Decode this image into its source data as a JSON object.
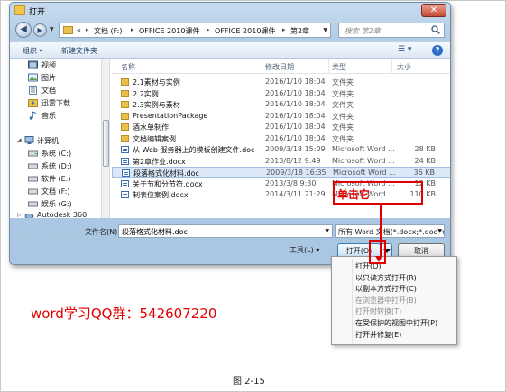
{
  "window": {
    "title": "打开",
    "close_label": "✕"
  },
  "address": {
    "prefix": "«",
    "crumbs": [
      "文档 (F:)",
      "OFFICE 2010课件",
      "OFFICE 2010课件",
      "第2章"
    ]
  },
  "search": {
    "placeholder": "搜索 第2章"
  },
  "toolbar": {
    "organize": "组织 ▾",
    "new_folder": "新建文件夹",
    "view": "☰ ▾",
    "help": "?"
  },
  "nav": {
    "items": [
      {
        "label": "视频",
        "icon": "video-library-icon"
      },
      {
        "label": "图片",
        "icon": "pictures-library-icon"
      },
      {
        "label": "文档",
        "icon": "documents-library-icon"
      },
      {
        "label": "迅雷下载",
        "icon": "thunder-download-icon"
      },
      {
        "label": "音乐",
        "icon": "music-library-icon"
      }
    ],
    "computer": {
      "label": "计算机",
      "icon": "computer-icon"
    },
    "drives": [
      {
        "label": "系统 (C:)"
      },
      {
        "label": "系统 (D:)"
      },
      {
        "label": "软件 (E:)"
      },
      {
        "label": "文档 (F:)"
      },
      {
        "label": "娱乐 (G:)"
      },
      {
        "label": "Autodesk 360"
      }
    ]
  },
  "columns": {
    "name": "名称",
    "date": "修改日期",
    "type": "类型",
    "size": "大小"
  },
  "files": [
    {
      "name": "2.1素材与实例",
      "date": "2016/1/10 18:04",
      "type": "文件夹",
      "size": "",
      "kind": "folder"
    },
    {
      "name": "2.2实例",
      "date": "2016/1/10 18:04",
      "type": "文件夹",
      "size": "",
      "kind": "folder"
    },
    {
      "name": "2.3实例与素材",
      "date": "2016/1/10 18:04",
      "type": "文件夹",
      "size": "",
      "kind": "folder"
    },
    {
      "name": "PresentationPackage",
      "date": "2016/1/10 18:04",
      "type": "文件夹",
      "size": "",
      "kind": "folder"
    },
    {
      "name": "酒水单制作",
      "date": "2016/1/10 18:04",
      "type": "文件夹",
      "size": "",
      "kind": "folder"
    },
    {
      "name": "文档编辑案例",
      "date": "2016/1/10 18:04",
      "type": "文件夹",
      "size": "",
      "kind": "folder"
    },
    {
      "name": "从 Web 服务器上的模板创建文件.doc",
      "date": "2009/3/18 15:09",
      "type": "Microsoft Word ...",
      "size": "28 KB",
      "kind": "doc"
    },
    {
      "name": "第2章作业.docx",
      "date": "2013/8/12 9:49",
      "type": "Microsoft Word ...",
      "size": "24 KB",
      "kind": "doc"
    },
    {
      "name": "段落格式化材料.doc",
      "date": "2009/3/18 16:35",
      "type": "Microsoft Word ...",
      "size": "36 KB",
      "kind": "doc",
      "selected": true
    },
    {
      "name": "关于节和分节符.docx",
      "date": "2013/3/8 9:30",
      "type": "Microsoft Word ...",
      "size": "12 KB",
      "kind": "doc"
    },
    {
      "name": "制表位案例.docx",
      "date": "2014/3/11 21:29",
      "type": "Microsoft Word ...",
      "size": "110 KB",
      "kind": "doc"
    }
  ],
  "filename": {
    "label": "文件名(N):",
    "value": "段落格式化材料.doc"
  },
  "filetype": {
    "value": "所有 Word 文档(*.docx;*.docm;*.dotx"
  },
  "buttons": {
    "tools": "工具(L) ▾",
    "open": "打开(O)",
    "cancel": "取消"
  },
  "open_menu": [
    {
      "label": "打开(O)",
      "enabled": true
    },
    {
      "label": "以只读方式打开(R)",
      "enabled": true
    },
    {
      "label": "以副本方式打开(C)",
      "enabled": true
    },
    {
      "label": "在浏览器中打开(B)",
      "enabled": false
    },
    {
      "label": "打开时转换(T)",
      "enabled": false
    },
    {
      "label": "在受保护的视图中打开(P)",
      "enabled": true
    },
    {
      "label": "打开并修复(E)",
      "enabled": true
    }
  ],
  "annotation": {
    "callout": "单击它",
    "color": "#e10000"
  },
  "qq_note": "word学习QQ群：542607220",
  "caption": "图 2-15"
}
